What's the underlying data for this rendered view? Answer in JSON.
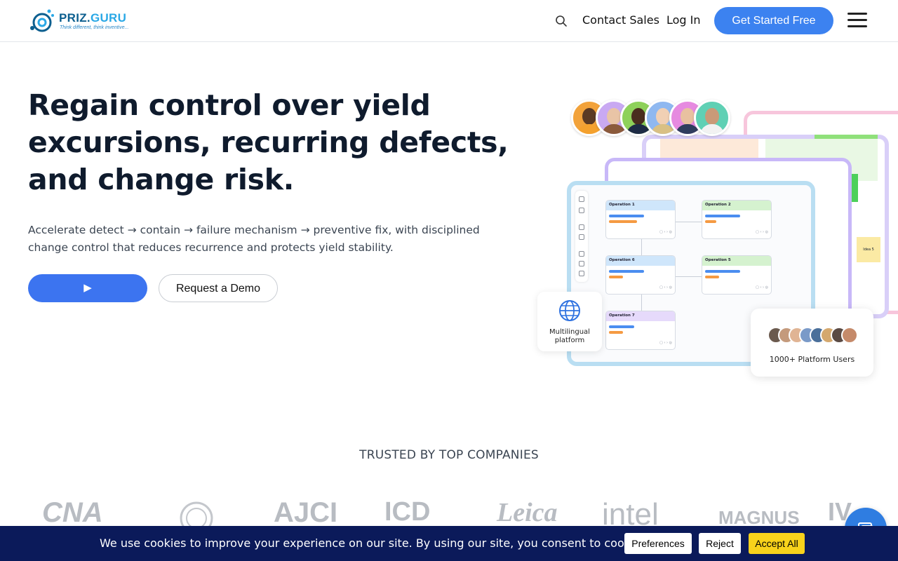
{
  "header": {
    "logo_text_a": "PRIZ.",
    "logo_text_b": "GURU",
    "logo_tagline": "Think different, think inventive...",
    "nav_contact": "Contact Sales",
    "nav_login": "Log In",
    "cta": "Get Started Free"
  },
  "hero": {
    "title": "Regain control over yield excursions, recurring defects, and change risk.",
    "subtitle": "Accelerate detect → contain → failure mechanism → preventive fix, with disciplined change control that reduces recurrence and protects yield stability.",
    "play_label": "▶",
    "demo_label": "Request a Demo"
  },
  "illustration": {
    "operations": [
      {
        "name": "Operation 1",
        "color": "#cfe6fb"
      },
      {
        "name": "Operation 2",
        "color": "#d5f2cf"
      },
      {
        "name": "Operation 6",
        "color": "#cfe6fb"
      },
      {
        "name": "Operation 5",
        "color": "#d5f2cf"
      },
      {
        "name": "Operation 7",
        "color": "#e6dafb"
      }
    ],
    "idea_label": "Idea 5",
    "multilingual_label": "Multilingual platform",
    "users_label": "1000+ Platform Users"
  },
  "trusted": {
    "heading": "TRUSTED BY TOP COMPANIES",
    "logos": [
      "CNA",
      "AJCI",
      "ICD",
      "Leica",
      "intel",
      "MAGNUS",
      "IV"
    ]
  },
  "cookie": {
    "text": "We use cookies to improve your experience on our site. By using our site, you consent to cookies.",
    "preferences": "Preferences",
    "reject": "Reject",
    "accept": "Accept All"
  },
  "colors": {
    "primary": "#3c82f0",
    "cookie_bg": "#0b1a5a",
    "accept": "#f8d21b"
  }
}
